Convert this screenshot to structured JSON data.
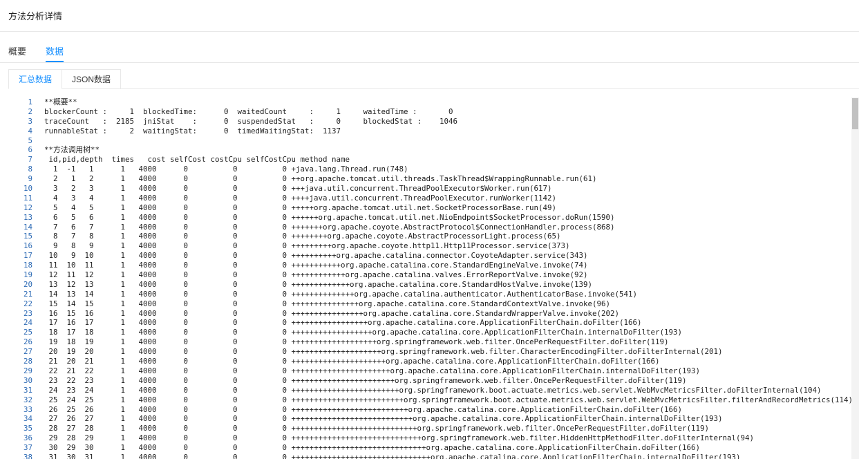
{
  "header": {
    "title": "方法分析详情"
  },
  "tabs": [
    {
      "label": "概要",
      "active": false
    },
    {
      "label": "数据",
      "active": true
    }
  ],
  "subtabs": [
    {
      "label": "汇总数据",
      "active": true
    },
    {
      "label": "JSON数据",
      "active": false
    }
  ],
  "code_lines": [
    "**概要**",
    "blockerCount :     1  blockedTime:      0  waitedCount     :     1     waitedTime :       0",
    "traceCount   :  2185  jniStat    :      0  suspendedStat   :     0     blockedStat :    1046",
    "runnableStat :     2  waitingStat:      0  timedWaitingStat:  1137",
    "",
    "**方法调用树**",
    " id,pid,depth  times   cost selfCost costCpu selfCostCpu method name",
    "  1  -1   1      1   4000      0          0          0 +java.lang.Thread.run(748)",
    "  2   1   2      1   4000      0          0          0 ++org.apache.tomcat.util.threads.TaskThread$WrappingRunnable.run(61)",
    "  3   2   3      1   4000      0          0          0 +++java.util.concurrent.ThreadPoolExecutor$Worker.run(617)",
    "  4   3   4      1   4000      0          0          0 ++++java.util.concurrent.ThreadPoolExecutor.runWorker(1142)",
    "  5   4   5      1   4000      0          0          0 +++++org.apache.tomcat.util.net.SocketProcessorBase.run(49)",
    "  6   5   6      1   4000      0          0          0 ++++++org.apache.tomcat.util.net.NioEndpoint$SocketProcessor.doRun(1590)",
    "  7   6   7      1   4000      0          0          0 +++++++org.apache.coyote.AbstractProtocol$ConnectionHandler.process(868)",
    "  8   7   8      1   4000      0          0          0 ++++++++org.apache.coyote.AbstractProcessorLight.process(65)",
    "  9   8   9      1   4000      0          0          0 +++++++++org.apache.coyote.http11.Http11Processor.service(373)",
    " 10   9  10      1   4000      0          0          0 ++++++++++org.apache.catalina.connector.CoyoteAdapter.service(343)",
    " 11  10  11      1   4000      0          0          0 +++++++++++org.apache.catalina.core.StandardEngineValve.invoke(74)",
    " 12  11  12      1   4000      0          0          0 ++++++++++++org.apache.catalina.valves.ErrorReportValve.invoke(92)",
    " 13  12  13      1   4000      0          0          0 +++++++++++++org.apache.catalina.core.StandardHostValve.invoke(139)",
    " 14  13  14      1   4000      0          0          0 ++++++++++++++org.apache.catalina.authenticator.AuthenticatorBase.invoke(541)",
    " 15  14  15      1   4000      0          0          0 +++++++++++++++org.apache.catalina.core.StandardContextValve.invoke(96)",
    " 16  15  16      1   4000      0          0          0 ++++++++++++++++org.apache.catalina.core.StandardWrapperValve.invoke(202)",
    " 17  16  17      1   4000      0          0          0 +++++++++++++++++org.apache.catalina.core.ApplicationFilterChain.doFilter(166)",
    " 18  17  18      1   4000      0          0          0 ++++++++++++++++++org.apache.catalina.core.ApplicationFilterChain.internalDoFilter(193)",
    " 19  18  19      1   4000      0          0          0 +++++++++++++++++++org.springframework.web.filter.OncePerRequestFilter.doFilter(119)",
    " 20  19  20      1   4000      0          0          0 ++++++++++++++++++++org.springframework.web.filter.CharacterEncodingFilter.doFilterInternal(201)",
    " 21  20  21      1   4000      0          0          0 +++++++++++++++++++++org.apache.catalina.core.ApplicationFilterChain.doFilter(166)",
    " 22  21  22      1   4000      0          0          0 ++++++++++++++++++++++org.apache.catalina.core.ApplicationFilterChain.internalDoFilter(193)",
    " 23  22  23      1   4000      0          0          0 +++++++++++++++++++++++org.springframework.web.filter.OncePerRequestFilter.doFilter(119)",
    " 24  23  24      1   4000      0          0          0 ++++++++++++++++++++++++org.springframework.boot.actuate.metrics.web.servlet.WebMvcMetricsFilter.doFilterInternal(104)",
    " 25  24  25      1   4000      0          0          0 +++++++++++++++++++++++++org.springframework.boot.actuate.metrics.web.servlet.WebMvcMetricsFilter.filterAndRecordMetrics(114)",
    " 26  25  26      1   4000      0          0          0 ++++++++++++++++++++++++++org.apache.catalina.core.ApplicationFilterChain.doFilter(166)",
    " 27  26  27      1   4000      0          0          0 +++++++++++++++++++++++++++org.apache.catalina.core.ApplicationFilterChain.internalDoFilter(193)",
    " 28  27  28      1   4000      0          0          0 ++++++++++++++++++++++++++++org.springframework.web.filter.OncePerRequestFilter.doFilter(119)",
    " 29  28  29      1   4000      0          0          0 +++++++++++++++++++++++++++++org.springframework.web.filter.HiddenHttpMethodFilter.doFilterInternal(94)",
    " 30  29  30      1   4000      0          0          0 ++++++++++++++++++++++++++++++org.apache.catalina.core.ApplicationFilterChain.doFilter(166)",
    " 31  30  31      1   4000      0          0          0 +++++++++++++++++++++++++++++++org.apache.catalina.core.ApplicationFilterChain.internalDoFilter(193)"
  ]
}
